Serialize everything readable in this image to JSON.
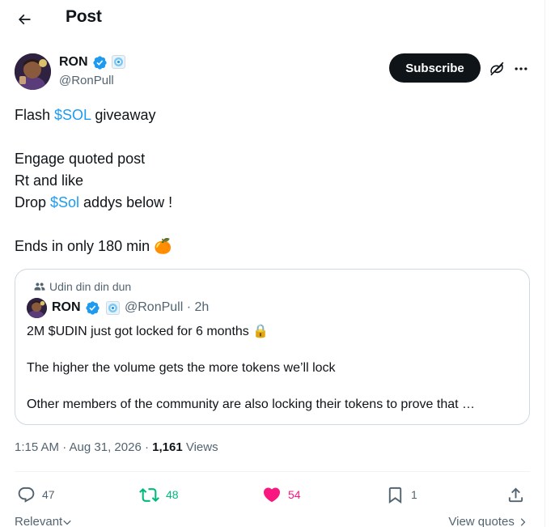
{
  "header": {
    "title": "Post",
    "back_icon": "arrow-left-icon"
  },
  "author": {
    "name": "RON",
    "handle": "@RonPull",
    "verified": true,
    "affiliate_badge": true
  },
  "subscribe_label": "Subscribe",
  "post": {
    "lines": [
      {
        "parts": [
          {
            "text": "Flash "
          },
          {
            "text": "$SOL",
            "cashtag": true
          },
          {
            "text": " giveaway"
          }
        ]
      },
      {
        "parts": []
      },
      {
        "parts": [
          {
            "text": "Engage quoted post"
          }
        ]
      },
      {
        "parts": [
          {
            "text": "Rt and like"
          }
        ]
      },
      {
        "parts": [
          {
            "text": "Drop "
          },
          {
            "text": "$Sol",
            "cashtag": true
          },
          {
            "text": " addys below !"
          }
        ]
      },
      {
        "parts": []
      },
      {
        "parts": [
          {
            "text": "Ends in only 180 min "
          },
          {
            "text": "🍊",
            "emoji": true
          }
        ]
      }
    ]
  },
  "quote": {
    "community": "Udin din din dun",
    "author": {
      "name": "RON",
      "handle": "@RonPull",
      "time": "2h"
    },
    "meta": "@RonPull · 2h",
    "lines": [
      "2M $UDIN just got locked for 6 months 🔒",
      "",
      "The higher the volume gets the more tokens we’ll lock",
      "",
      "Other members of the community are also locking their tokens to prove that …"
    ]
  },
  "timestamp": {
    "text": "1:15 AM · Aug 31, 2026 · ",
    "views_count": "1,161",
    "views_label": " Views"
  },
  "actions": {
    "replies": "47",
    "reposts": "48",
    "likes": "54",
    "bookmarks": "1"
  },
  "colors": {
    "accent": "#1d9bf0",
    "repost": "#00ba7c",
    "like": "#f91880",
    "text": "#0f1419",
    "muted": "#536471"
  },
  "bottom": {
    "relevant": "Relevant",
    "view_quotes": "View quotes"
  }
}
